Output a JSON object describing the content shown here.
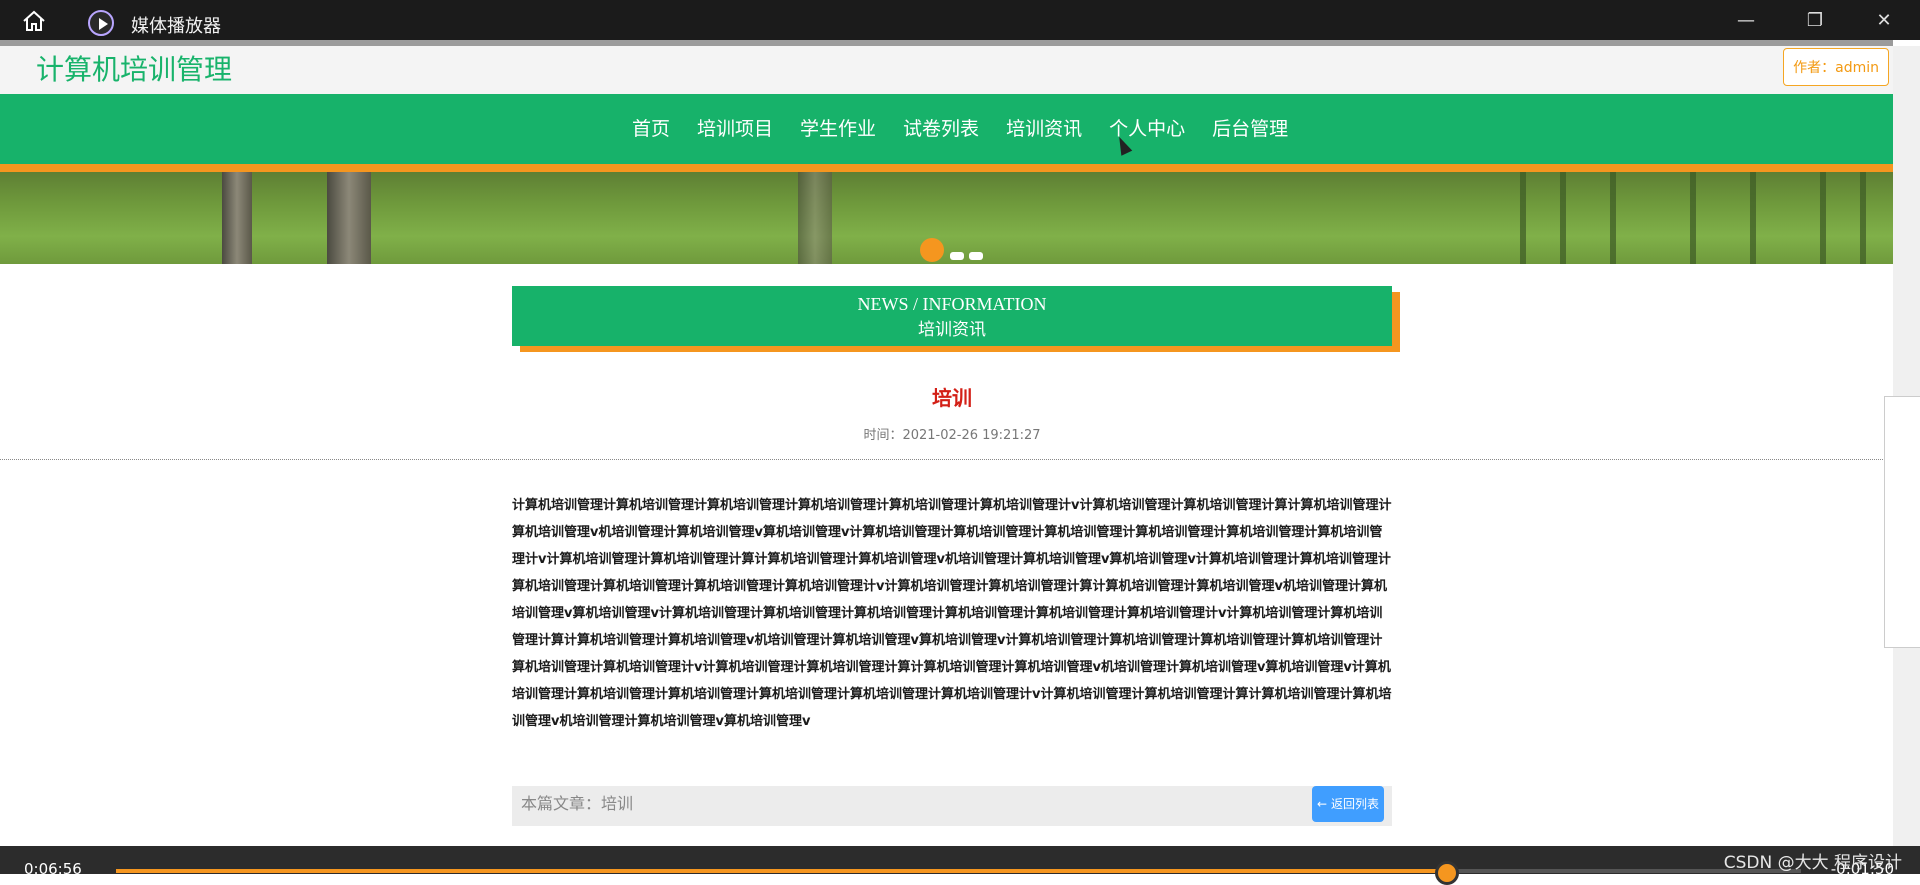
{
  "window": {
    "title": "媒体播放器",
    "icons": {
      "home": "home-icon",
      "app": "play-icon",
      "minimize": "minimize-icon",
      "maximize": "restore-icon",
      "close": "close-icon"
    }
  },
  "site": {
    "title": "计算机培训管理",
    "author_label": "作者：admin"
  },
  "nav": {
    "items": [
      "首页",
      "培训项目",
      "学生作业",
      "试卷列表",
      "培训资讯",
      "个人中心",
      "后台管理"
    ]
  },
  "news": {
    "header_en": "NEWS / INFORMATION",
    "header_cn": "培训资讯"
  },
  "article": {
    "title": "培训",
    "time": "时间：2021-02-26 19:21:27",
    "body": "计算机培训管理计算机培训管理计算机培训管理计算机培训管理计算机培训管理计算机培训管理计v计算机培训管理计算机培训管理计算计算机培训管理计算机培训管理v机培训管理计算机培训管理v算机培训管理v计算机培训管理计算机培训管理计算机培训管理计算机培训管理计算机培训管理计算机培训管理计v计算机培训管理计算机培训管理计算计算机培训管理计算机培训管理v机培训管理计算机培训管理v算机培训管理v计算机培训管理计算机培训管理计算机培训管理计算机培训管理计算机培训管理计算机培训管理计v计算机培训管理计算机培训管理计算计算机培训管理计算机培训管理v机培训管理计算机培训管理v算机培训管理v计算机培训管理计算机培训管理计算机培训管理计算机培训管理计算机培训管理计算机培训管理计v计算机培训管理计算机培训管理计算计算机培训管理计算机培训管理v机培训管理计算机培训管理v算机培训管理v计算机培训管理计算机培训管理计算机培训管理计算机培训管理计算机培训管理计算机培训管理计v计算机培训管理计算机培训管理计算计算机培训管理计算机培训管理v机培训管理计算机培训管理v算机培训管理v计算机培训管理计算机培训管理计算机培训管理计算机培训管理计算机培训管理计算机培训管理计v计算机培训管理计算机培训管理计算计算机培训管理计算机培训管理v机培训管理计算机培训管理v算机培训管理v",
    "footer_label": "本篇文章：培训",
    "back_button": "返回列表"
  },
  "player": {
    "elapsed": "0:06:56",
    "remaining": "-0:01:50",
    "progress": 0.79,
    "watermark": "CSDN @大大 程序设计"
  },
  "colors": {
    "accent_green": "#17b26a",
    "accent_orange": "#f5961f",
    "title_red": "#d32017"
  }
}
